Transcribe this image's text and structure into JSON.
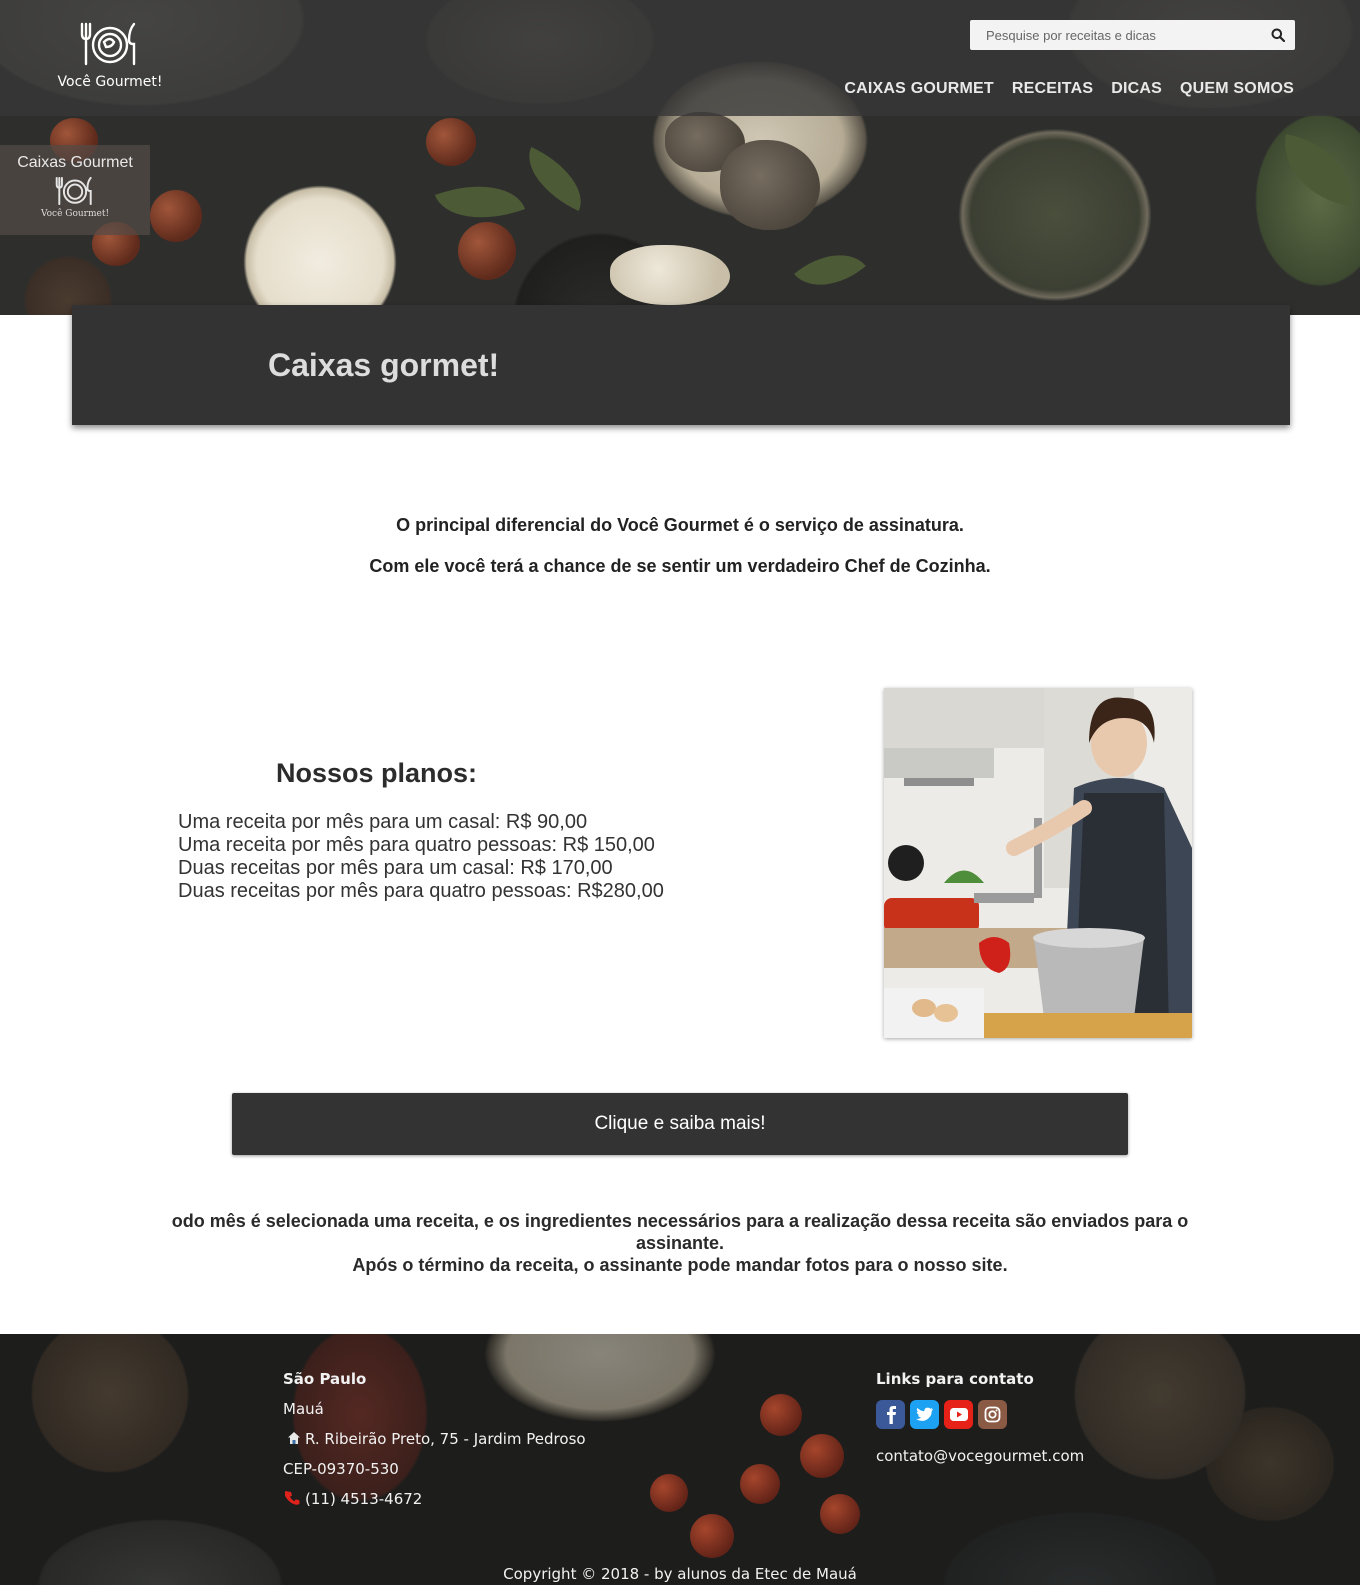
{
  "header": {
    "brand_name": "Você Gourmet!",
    "search": {
      "placeholder": "Pesquise por receitas e dicas",
      "value": ""
    },
    "nav": [
      "CAIXAS GOURMET",
      "RECEITAS",
      "DICAS",
      "QUEM SOMOS"
    ]
  },
  "side_badge": {
    "title": "Caixas Gourmet",
    "brand": "Você Gourmet!"
  },
  "page_title": "Caixas gormet!",
  "intro": [
    "O principal diferencial do Você Gourmet é o serviço de assinatura.",
    "Com ele você terá a chance de se sentir um verdadeiro Chef de Cozinha."
  ],
  "plans": {
    "title": "Nossos planos:",
    "items": [
      "Uma receita por mês para um casal: R$ 90,00",
      "Uma receita por mês para quatro pessoas: R$ 150,00",
      "Duas receitas por mês para um casal: R$ 170,00",
      "Duas receitas por mês para quatro pessoas: R$280,00"
    ]
  },
  "cta_label": "Clique e saiba mais!",
  "description": [
    "odo mês é selecionada uma receita, e os ingredientes necessários para a realização dessa receita são enviados para o assinante.",
    "Após o término da receita, o assinante pode mandar fotos para o nosso site."
  ],
  "footer": {
    "city": "São Paulo",
    "town": "Mauá",
    "address": "R. Ribeirão Preto, 75 - Jardim Pedroso",
    "cep": "CEP-09370-530",
    "phone": "(11) 4513-4672",
    "links_title": "Links para contato",
    "social_icons": [
      "facebook-icon",
      "twitter-icon",
      "youtube-icon",
      "instagram-icon"
    ],
    "email": "contato@vocegourmet.com",
    "copyright": "Copyright © 2018 - by alunos da Etec de Mauá"
  },
  "colors": {
    "dark": "#333333",
    "facebook": "#3b5998",
    "twitter": "#1da1f2",
    "youtube": "#e62117",
    "instagram": "#8a5a44"
  }
}
